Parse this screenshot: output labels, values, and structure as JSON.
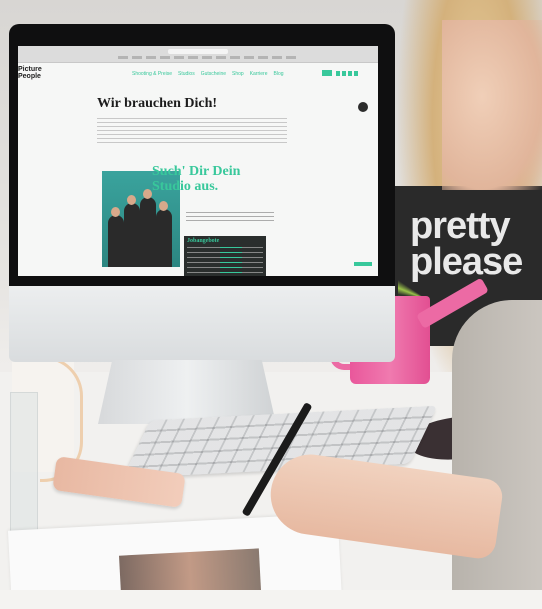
{
  "screen": {
    "site_logo": "Picture\nPeople",
    "nav": [
      "Shooting & Preise",
      "Studios",
      "Gutscheine",
      "Shop",
      "Karriere",
      "Blog"
    ],
    "headline": "Wir brauchen Dich!",
    "green_title": "Such' Dir Dein Studio aus.",
    "promo_title": "Jobangebote"
  },
  "background_sign": "pretty please",
  "colors": {
    "accent_green": "#38c89b",
    "watering_can_pink": "#ec6aa4"
  }
}
